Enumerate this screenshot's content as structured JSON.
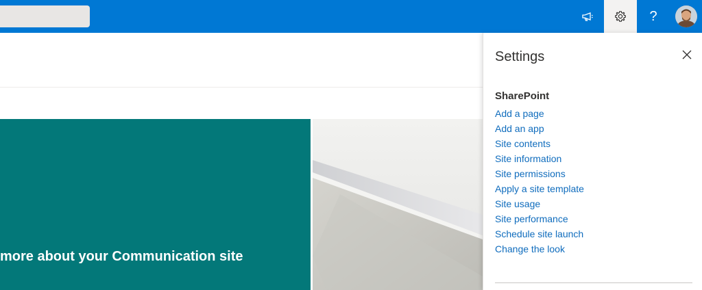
{
  "topbar": {
    "help_label": "?",
    "icons": {
      "megaphone": "megaphone-icon",
      "settings": "gear-icon",
      "help": "help-icon"
    }
  },
  "hero": {
    "title": "more about your Communication site"
  },
  "settings_panel": {
    "title": "Settings",
    "section_title": "SharePoint",
    "links": [
      "Add a page",
      "Add an app",
      "Site contents",
      "Site information",
      "Site permissions",
      "Apply a site template",
      "Site usage",
      "Site performance",
      "Schedule site launch",
      "Change the look"
    ]
  },
  "colors": {
    "suite_bar": "#0078d4",
    "hero_teal": "#037879",
    "link": "#0f6cbd"
  }
}
